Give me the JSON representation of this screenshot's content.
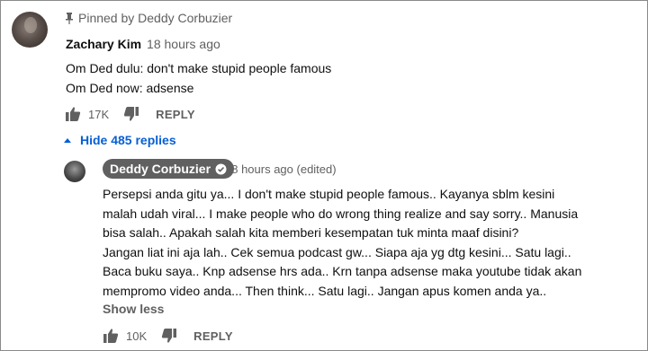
{
  "pinned": {
    "text": "Pinned by Deddy Corbuzier"
  },
  "comment": {
    "author": "Zachary Kim",
    "timestamp": "18 hours ago",
    "lines": [
      "Om Ded dulu: don't make stupid people famous",
      "Om Ded now: adsense"
    ],
    "likes": "17K",
    "reply_label": "REPLY"
  },
  "replies_toggle": {
    "label": "Hide 485 replies"
  },
  "reply": {
    "author": "Deddy Corbuzier",
    "meta": "18 hours ago (edited)",
    "lines": [
      "Persepsi anda gitu ya... I don't make stupid people famous..  Kayanya sblm kesini",
      "malah udah viral... I make people who do wrong thing realize and say sorry.. Manusia",
      "bisa salah.. Apakah salah kita memberi kesempatan tuk minta maaf disini?",
      "Jangan liat ini aja lah.. Cek semua podcast gw... Siapa aja yg dtg kesini... Satu lagi..",
      "Baca buku saya.. Knp adsense hrs ada.. Krn tanpa adsense maka youtube tidak akan",
      "mempromo video anda... Then think... Satu lagi.. Jangan apus komen anda ya.."
    ],
    "show_less": "Show less",
    "likes": "10K",
    "reply_label": "REPLY"
  },
  "colors": {
    "link_blue": "#065fd4",
    "secondary_text": "#606060",
    "badge_bg": "#606060"
  },
  "icons": [
    "pin-icon",
    "thumbs-up-icon",
    "thumbs-down-icon",
    "caret-up-icon",
    "verified-check-icon"
  ]
}
